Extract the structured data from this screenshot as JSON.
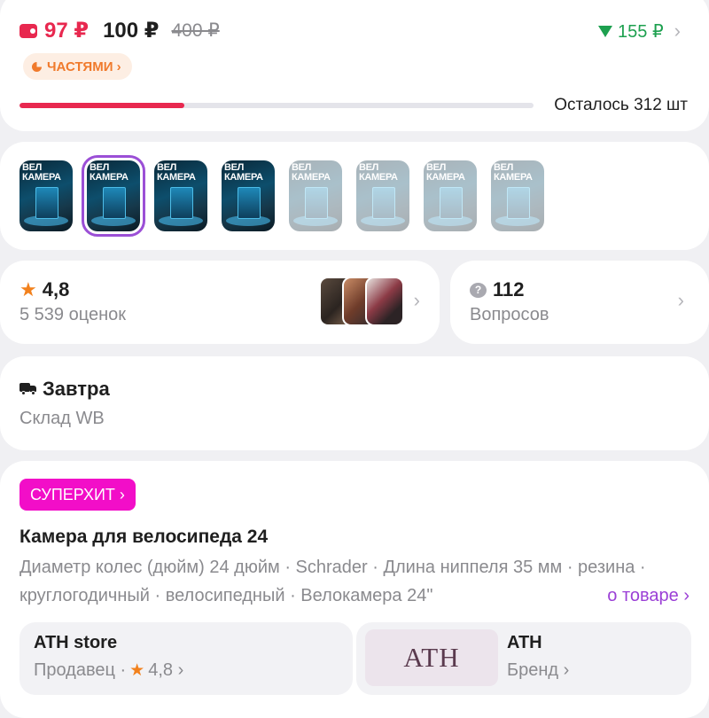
{
  "price": {
    "wallet_price": "97 ₽",
    "main_price": "100 ₽",
    "old_price": "400 ₽",
    "price_drop": "155 ₽",
    "chevron": "›",
    "installments_label": "ЧАСТЯМИ ›",
    "stock_text": "Осталось 312 шт",
    "stock_progress_fraction": 0.32,
    "accent_color": "#e8284f",
    "drop_color": "#1da04f"
  },
  "gallery": {
    "thumbnails": [
      {
        "text": "ВЕЛ КАМЕРА",
        "selected": false,
        "faded": false
      },
      {
        "text": "ВЕЛ КАМЕРА",
        "selected": true,
        "faded": false
      },
      {
        "text": "ВЕЛ КАМЕРА",
        "selected": false,
        "faded": false
      },
      {
        "text": "ВЕЛ КАМЕРА",
        "selected": false,
        "faded": false
      },
      {
        "text": "ВЕЛ КАМЕРА",
        "selected": false,
        "faded": true
      },
      {
        "text": "ВЕЛ КАМЕРА",
        "selected": false,
        "faded": true
      },
      {
        "text": "ВЕЛ КАМЕРА",
        "selected": false,
        "faded": true
      },
      {
        "text": "ВЕЛ КАМЕРА",
        "selected": false,
        "faded": true
      }
    ],
    "selected_outline_color": "#9b4fd6"
  },
  "rating": {
    "value": "4,8",
    "count_label": "5 539 оценок",
    "chevron": "›"
  },
  "questions": {
    "count": "112",
    "label": "Вопросов",
    "icon_glyph": "?",
    "chevron": "›"
  },
  "delivery": {
    "when": "Завтра",
    "warehouse": "Склад WB"
  },
  "product": {
    "badge": "СУПЕРХИТ ›",
    "badge_color": "#f20ec8",
    "title": "Камера для велосипеда 24",
    "description": "Диаметр колес (дюйм) 24 дюйм · Schrader · Длина ниппеля 35 мм · резина · круглогодичный · велосипедный · Велокамера 24\"",
    "more_link": "о товаре ›",
    "seller": {
      "name": "ATH store",
      "role_prefix": "Продавец ·",
      "rating": "4,8 ›"
    },
    "brand": {
      "logo_text": "ATH",
      "name": "ATH",
      "role": "Бренд ›"
    }
  }
}
